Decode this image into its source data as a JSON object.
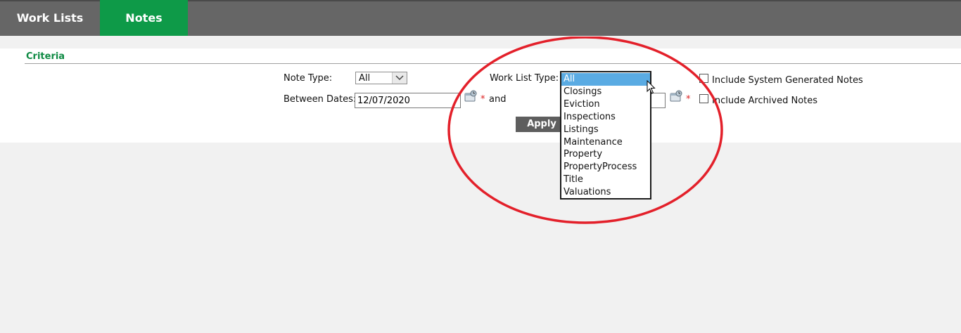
{
  "tabs": [
    {
      "label": "Work Lists"
    },
    {
      "label": "Notes",
      "active": true
    }
  ],
  "criteria": {
    "title": "Criteria",
    "note_type_label": "Note Type:",
    "note_type_value": "All",
    "between_dates_label": "Between Dates:",
    "start_date_value": "12/07/2020",
    "and_label": "and",
    "end_date_value": "",
    "required_marker": "*",
    "work_list_type_label": "Work List Type:",
    "work_list_type_value": "All",
    "work_list_type_options": [
      "All",
      "Closings",
      "Eviction",
      "Inspections",
      "Listings",
      "Maintenance",
      "Property",
      "PropertyProcess",
      "Title",
      "Valuations"
    ],
    "include_system_label": "Include System Generated Notes",
    "include_archived_label": "Include Archived Notes",
    "apply_label": "Apply"
  },
  "colors": {
    "topbar": "#666666",
    "active_tab": "#0e9a48",
    "criteria_title": "#0e8a43",
    "dropdown_selected": "#5aabe3",
    "annotation_circle": "#e3202a"
  },
  "icons": [
    "calendar-icon",
    "dropdown-arrow-icon",
    "mouse-pointer-icon"
  ]
}
